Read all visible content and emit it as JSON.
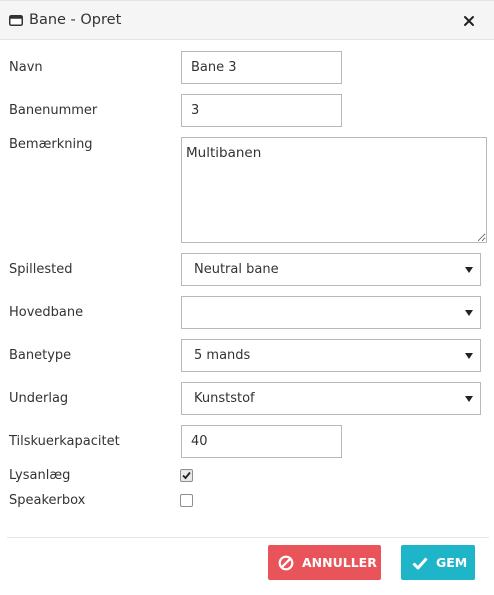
{
  "dialog": {
    "title": "Bane - Opret",
    "icons": {
      "window": "window-icon",
      "close": "close-icon"
    }
  },
  "form": {
    "navn": {
      "label": "Navn",
      "value": "Bane 3"
    },
    "banenummer": {
      "label": "Banenummer",
      "value": "3"
    },
    "bemaerkning": {
      "label": "Bemærkning",
      "value": "Multibanen"
    },
    "spillested": {
      "label": "Spillested",
      "value": "Neutral bane"
    },
    "hovedbane": {
      "label": "Hovedbane",
      "value": ""
    },
    "banetype": {
      "label": "Banetype",
      "value": "5 mands"
    },
    "underlag": {
      "label": "Underlag",
      "value": "Kunststof"
    },
    "tilskuerkapacitet": {
      "label": "Tilskuerkapacitet",
      "value": "40"
    },
    "lysanlaeg": {
      "label": "Lysanlæg",
      "checked": true
    },
    "speakerbox": {
      "label": "Speakerbox",
      "checked": false
    }
  },
  "footer": {
    "cancel_label": "ANNULLER",
    "save_label": "GEM",
    "cancel_icon": "ban-icon",
    "save_icon": "check-icon"
  },
  "colors": {
    "cancel": "#e8545a",
    "save": "#1fb5c8",
    "header_bg": "#f5f5f5"
  }
}
